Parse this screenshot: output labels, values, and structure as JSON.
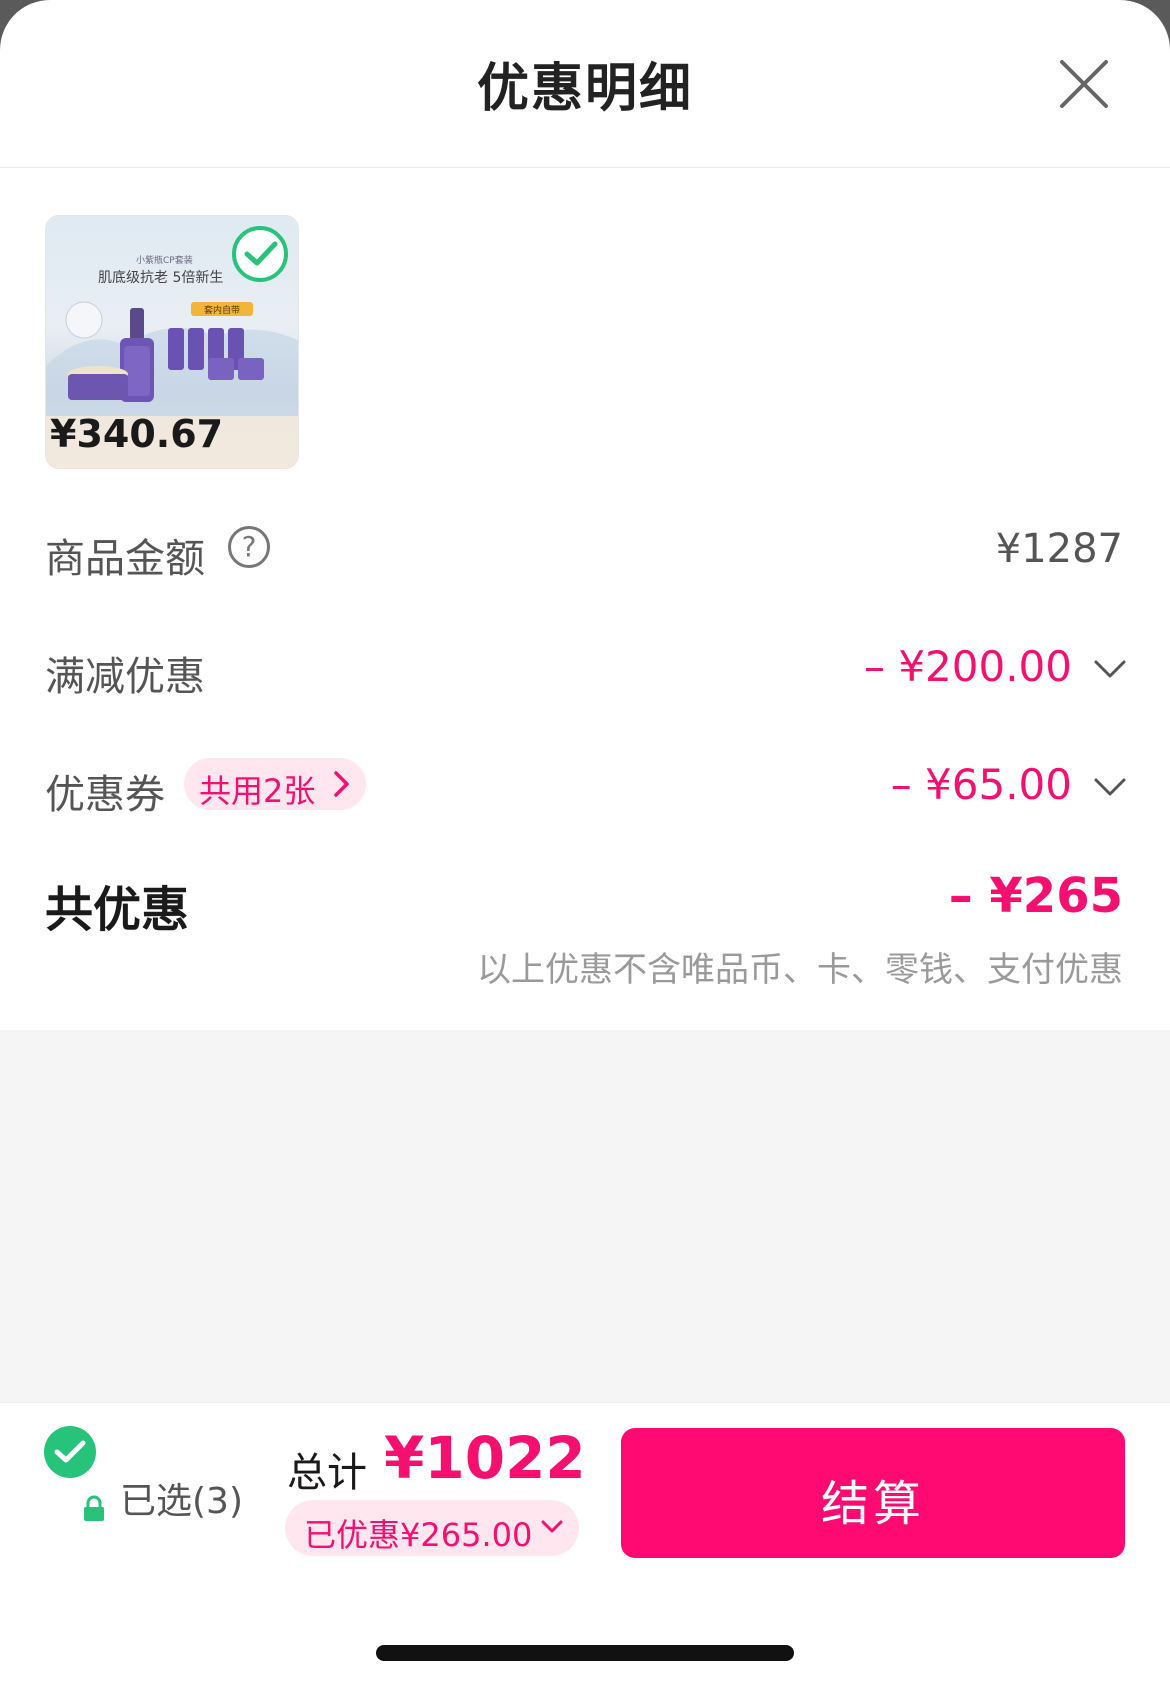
{
  "header": {
    "title": "优惠明细"
  },
  "product": {
    "thumb_price": "¥340.67",
    "thumb_caption_top": "小紫瓶CP套装",
    "thumb_headline": "肌底级抗老 5倍新生",
    "thumb_badge": "套内自带"
  },
  "rows": {
    "goods_amount_label": "商品金额",
    "goods_amount_value": "¥1287",
    "full_reduction_label": "满减优惠",
    "full_reduction_value": "– ¥200.00",
    "coupon_label": "优惠券",
    "coupon_pill": "共用2张",
    "coupon_value": "– ¥65.00",
    "total_discount_label": "共优惠",
    "total_discount_value": "– ¥265",
    "note": "以上优惠不含唯品币、卡、零钱、支付优惠"
  },
  "bottom": {
    "selected": "已选(3)",
    "sum_label": "总计",
    "sum_value": "¥1022",
    "saved": "已优惠¥265.00",
    "checkout": "结算"
  },
  "colors": {
    "accent": "#f5106f",
    "button": "#ff0a73",
    "check": "#27c37a"
  }
}
